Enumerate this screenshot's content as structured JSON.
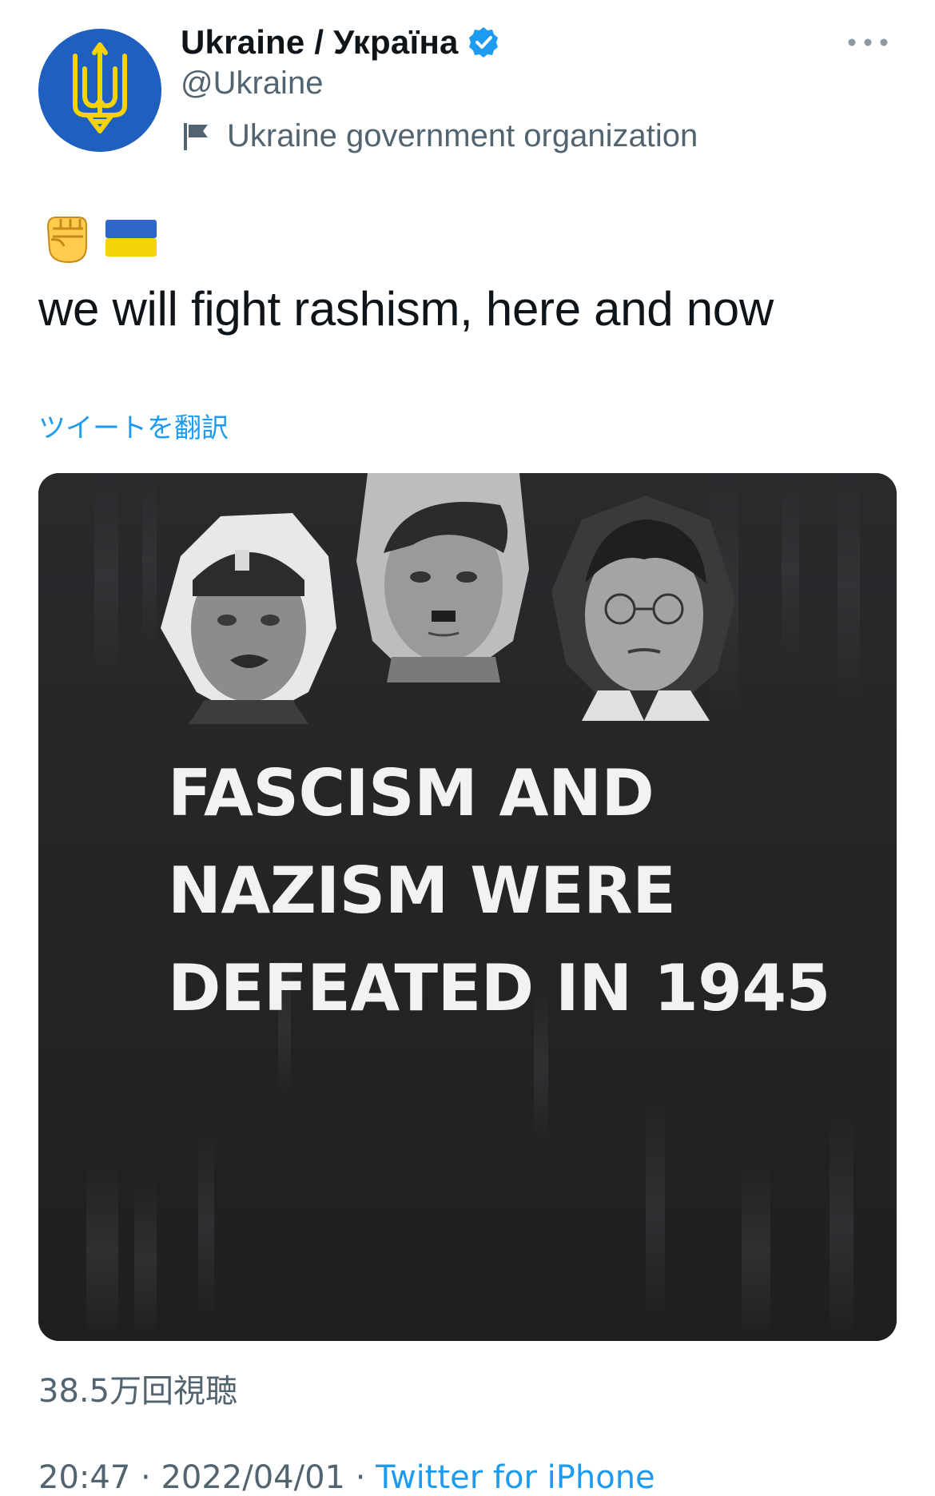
{
  "account": {
    "display_name": "Ukraine / Україна",
    "handle": "@Ukraine",
    "affiliation": "Ukraine government organization",
    "verified": true,
    "avatar_colors": {
      "background": "#1f5fbf",
      "emblem": "#f5d20a"
    }
  },
  "tweet": {
    "emojis": [
      "raised-fist",
      "ukraine-flag"
    ],
    "text": "we will fight rashism, here and now",
    "translate_label": "ツイートを翻訳"
  },
  "media": {
    "type": "video",
    "caption_lines": [
      "FASCISM AND",
      "NAZISM WERE",
      "DEFEATED IN 1945"
    ]
  },
  "footer": {
    "views": "38.5万回視聴",
    "time": "20:47",
    "date": "2022/04/01",
    "separator": " · ",
    "source": "Twitter for iPhone"
  },
  "colors": {
    "link": "#1d9bf0",
    "secondary_text": "#536471",
    "verified_badge": "#1d9bf0",
    "media_background": "#262628"
  }
}
